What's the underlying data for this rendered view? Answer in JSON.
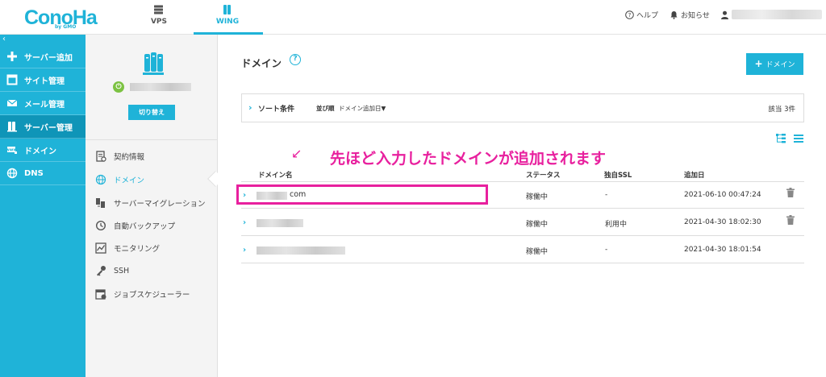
{
  "app": {
    "logo": "ConoHa",
    "logo_sub": "by GMO"
  },
  "topnav": {
    "vps": "VPS",
    "wing": "WING",
    "help": "ヘルプ",
    "notice": "お知らせ"
  },
  "sidebar": {
    "collapse": "‹",
    "items": [
      {
        "label": "サーバー追加",
        "icon": "plus-icon"
      },
      {
        "label": "サイト管理",
        "icon": "window-icon"
      },
      {
        "label": "メール管理",
        "icon": "mail-icon"
      },
      {
        "label": "サーバー管理",
        "icon": "server-icon"
      },
      {
        "label": "ドメイン",
        "icon": "domain-icon"
      },
      {
        "label": "DNS",
        "icon": "globe-icon"
      }
    ]
  },
  "subpanel": {
    "switch_label": "切り替え",
    "power": "⏻",
    "items": [
      {
        "label": "契約情報",
        "icon": "contract-icon"
      },
      {
        "label": "ドメイン",
        "icon": "globe-icon"
      },
      {
        "label": "サーバーマイグレーション",
        "icon": "migration-icon"
      },
      {
        "label": "自動バックアップ",
        "icon": "backup-icon"
      },
      {
        "label": "モニタリング",
        "icon": "chart-icon"
      },
      {
        "label": "SSH",
        "icon": "key-icon"
      },
      {
        "label": "ジョブスケジューラー",
        "icon": "calendar-icon"
      }
    ]
  },
  "main": {
    "title": "ドメイン",
    "help": "?",
    "add_button": "ドメイン",
    "add_button_plus": "+",
    "sort": {
      "label": "ソート条件",
      "order_label": "並び順",
      "order_value": "ドメイン追加日▼",
      "count": "該当 3件"
    },
    "annotation": "先ほど入力したドメインが追加されます",
    "annotation_arrow": "↙",
    "columns": [
      "ドメイン名",
      "ステータス",
      "独自SSL",
      "追加日"
    ],
    "rows": [
      {
        "domain_suffix": "com",
        "status": "稼働中",
        "ssl": "-",
        "date": "2021-06-10 00:47:24",
        "trash": true
      },
      {
        "domain_suffix": "",
        "status": "稼働中",
        "ssl": "利用中",
        "date": "2021-04-30 18:02:30",
        "trash": true
      },
      {
        "domain_suffix": "",
        "status": "稼働中",
        "ssl": "-",
        "date": "2021-04-30 18:01:54",
        "trash": false
      }
    ]
  },
  "colors": {
    "accent": "#1fb3d8",
    "accent_dark": "#0f95b8",
    "highlight": "#e8209e",
    "power_green": "#7cc242"
  }
}
